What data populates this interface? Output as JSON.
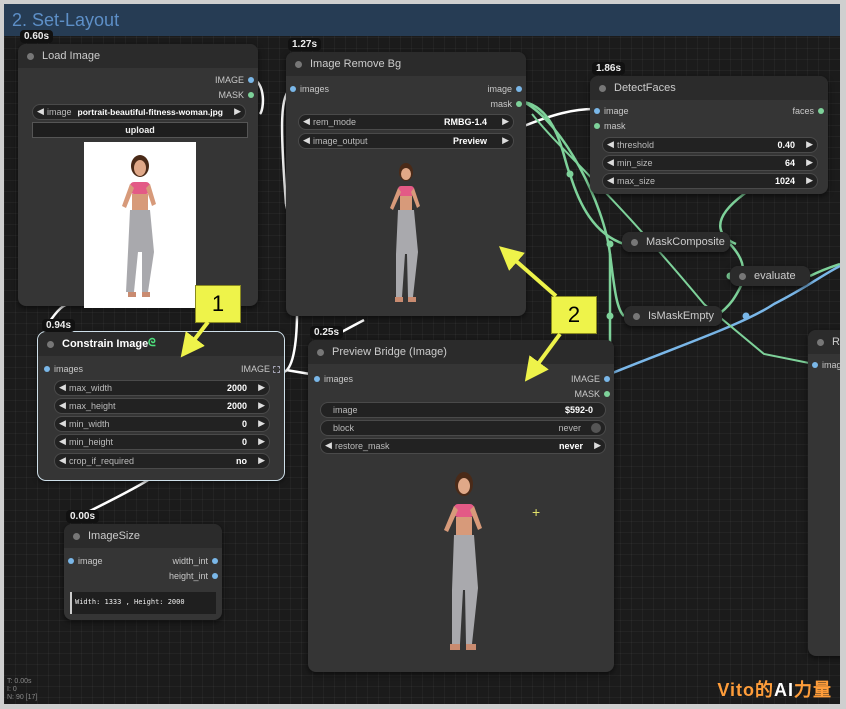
{
  "group": {
    "title": "2. Set-Layout"
  },
  "nodes": {
    "load_image": {
      "time": "0.60s",
      "title": "Load Image",
      "outputs": [
        "IMAGE",
        "MASK"
      ],
      "image_widget": {
        "label": "image",
        "value": "portrait-beautiful-fitness-woman.jpg"
      },
      "upload_label": "upload"
    },
    "remove_bg": {
      "time": "1.27s",
      "title": "Image Remove Bg",
      "input": "images",
      "outputs": [
        "image",
        "mask"
      ],
      "widgets": [
        {
          "label": "rem_mode",
          "value": "RMBG-1.4"
        },
        {
          "label": "image_output",
          "value": "Preview"
        }
      ]
    },
    "detect_faces": {
      "time": "1.86s",
      "title": "DetectFaces",
      "inputs": [
        "image",
        "mask"
      ],
      "output": "faces",
      "widgets": [
        {
          "label": "threshold",
          "value": "0.40"
        },
        {
          "label": "min_size",
          "value": "64"
        },
        {
          "label": "max_size",
          "value": "1024"
        }
      ]
    },
    "mask_composite": {
      "title": "MaskComposite"
    },
    "evaluate": {
      "title": "evaluate"
    },
    "is_mask_empty": {
      "title": "IsMaskEmpty"
    },
    "right_partial": {
      "title": "Re",
      "input": "imag"
    },
    "constrain_image": {
      "time": "0.94s",
      "title": "Constrain Image",
      "input": "images",
      "output": "IMAGE",
      "widgets": [
        {
          "label": "max_width",
          "value": "2000"
        },
        {
          "label": "max_height",
          "value": "2000"
        },
        {
          "label": "min_width",
          "value": "0"
        },
        {
          "label": "min_height",
          "value": "0"
        },
        {
          "label": "crop_if_required",
          "value": "no"
        }
      ]
    },
    "preview_bridge": {
      "time": "0.25s",
      "title": "Preview Bridge (Image)",
      "input": "images",
      "outputs": [
        "IMAGE",
        "MASK"
      ],
      "widgets": [
        {
          "label": "image",
          "value": "$592-0"
        },
        {
          "label": "block",
          "value": "never"
        },
        {
          "label": "restore_mask",
          "value": "never"
        }
      ]
    },
    "image_size": {
      "time": "0.00s",
      "title": "ImageSize",
      "input": "image",
      "outputs": [
        "width_int",
        "height_int"
      ],
      "text": "Width: 1333 , Height: 2000"
    }
  },
  "callouts": [
    "1",
    "2",
    "2"
  ],
  "status": [
    "T: 0.00s",
    "I: 0",
    "N: 90 [17]"
  ],
  "watermark": {
    "prefix": "Vito的",
    "middle": "AI",
    "suffix": "力量"
  },
  "colors": {
    "image_wire": "#7ab7e8",
    "mask_wire": "#7ed29a",
    "group_bar": "#263c54",
    "callout": "#eef34a"
  },
  "icons": [
    "chevron-left-icon",
    "chevron-right-icon",
    "link-icon",
    "grid-icon",
    "crosshair-icon"
  ]
}
